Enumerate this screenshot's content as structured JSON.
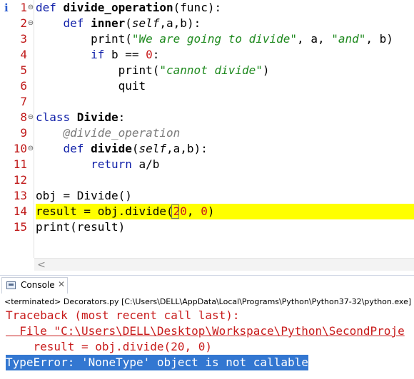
{
  "editor": {
    "lines": [
      {
        "n": "1",
        "fold": "⊖",
        "parts": [
          {
            "t": "def ",
            "c": "kw"
          },
          {
            "t": "divide_operation",
            "c": "def"
          },
          {
            "t": "(func):",
            "c": "plain"
          }
        ]
      },
      {
        "n": "2",
        "fold": "⊖",
        "parts": [
          {
            "t": "    def ",
            "c": "kw"
          },
          {
            "t": "inner",
            "c": "def"
          },
          {
            "t": "(",
            "c": "plain"
          },
          {
            "t": "self",
            "c": "self"
          },
          {
            "t": ",a,b):",
            "c": "plain"
          }
        ]
      },
      {
        "n": "3",
        "fold": "",
        "parts": [
          {
            "t": "        print(",
            "c": "plain"
          },
          {
            "t": "\"We are going to divide\"",
            "c": "str"
          },
          {
            "t": ", a, ",
            "c": "plain"
          },
          {
            "t": "\"and\"",
            "c": "str"
          },
          {
            "t": ", b)",
            "c": "plain"
          }
        ]
      },
      {
        "n": "4",
        "fold": "",
        "parts": [
          {
            "t": "        if ",
            "c": "kw"
          },
          {
            "t": "b == ",
            "c": "plain"
          },
          {
            "t": "0",
            "c": "num"
          },
          {
            "t": ":",
            "c": "plain"
          }
        ]
      },
      {
        "n": "5",
        "fold": "",
        "parts": [
          {
            "t": "            print(",
            "c": "plain"
          },
          {
            "t": "\"cannot divide\"",
            "c": "str"
          },
          {
            "t": ")",
            "c": "plain"
          }
        ]
      },
      {
        "n": "6",
        "fold": "",
        "parts": [
          {
            "t": "            quit",
            "c": "plain"
          }
        ]
      },
      {
        "n": "7",
        "fold": "",
        "parts": []
      },
      {
        "n": "8",
        "fold": "⊖",
        "parts": [
          {
            "t": "class ",
            "c": "kw"
          },
          {
            "t": "Divide",
            "c": "def"
          },
          {
            "t": ":",
            "c": "plain"
          }
        ]
      },
      {
        "n": "9",
        "fold": "",
        "parts": [
          {
            "t": "    @divide_operation",
            "c": "deco"
          }
        ]
      },
      {
        "n": "10",
        "fold": "⊖",
        "parts": [
          {
            "t": "    def ",
            "c": "kw"
          },
          {
            "t": "divide",
            "c": "def"
          },
          {
            "t": "(",
            "c": "plain"
          },
          {
            "t": "self",
            "c": "self"
          },
          {
            "t": ",a,b):",
            "c": "plain"
          }
        ]
      },
      {
        "n": "11",
        "fold": "",
        "parts": [
          {
            "t": "        return ",
            "c": "kw"
          },
          {
            "t": "a/b",
            "c": "plain"
          }
        ]
      },
      {
        "n": "12",
        "fold": "",
        "parts": []
      },
      {
        "n": "13",
        "fold": "",
        "parts": [
          {
            "t": "obj = Divide()",
            "c": "plain"
          }
        ]
      },
      {
        "n": "14",
        "fold": "",
        "highlight": true,
        "parts": [
          {
            "t": "result = obj.divide(",
            "c": "plain"
          },
          {
            "t": "20",
            "c": "num"
          },
          {
            "t": ", ",
            "c": "plain"
          },
          {
            "t": "0",
            "c": "num"
          },
          {
            "t": ")",
            "c": "plain"
          }
        ]
      },
      {
        "n": "15",
        "fold": "",
        "parts": [
          {
            "t": "print(result)",
            "c": "plain"
          }
        ]
      }
    ]
  },
  "hscroll": {
    "left_arrow": "<"
  },
  "console": {
    "tab_label": "Console",
    "close_glyph": "✕",
    "status": "<terminated> Decorators.py [C:\\Users\\DELL\\AppData\\Local\\Programs\\Python\\Python37-32\\python.exe]",
    "output": [
      "Traceback (most recent call last):",
      "  File \"C:\\Users\\DELL\\Desktop\\Workspace\\Python\\SecondProje",
      "    result = obj.divide(20, 0)",
      "TypeError: 'NoneType' object is not callable"
    ]
  },
  "colors": {
    "keyword": "#0f1fa8",
    "string": "#1f8a1f",
    "number": "#c81b1b",
    "line_number": "#c01a1a",
    "highlight": "#ffff00",
    "error_text": "#c81b1b",
    "selection": "#3377d1"
  },
  "icons": {
    "info": "info-icon",
    "fold": "fold-minus-icon",
    "console": "console-icon",
    "close": "close-icon"
  }
}
